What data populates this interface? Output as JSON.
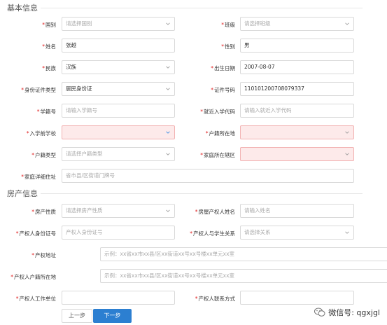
{
  "sections": {
    "basic": "基本信息",
    "property": "房产信息"
  },
  "basic": {
    "country_label": "国别",
    "country_placeholder": "请选择国别",
    "class_label": "班级",
    "class_placeholder": "请选择班级",
    "name_label": "姓名",
    "name_value": "张越",
    "gender_label": "性别",
    "gender_value": "男",
    "ethnicity_label": "民族",
    "ethnicity_value": "汉族",
    "birthdate_label": "出生日期",
    "birthdate_value": "2007-08-07",
    "idtype_label": "身份证件类型",
    "idtype_value": "居民身份证",
    "idnum_label": "证件号码",
    "idnum_value": "110101200708079337",
    "studentno_label": "学籍号",
    "studentno_placeholder": "请输入学籍号",
    "admission_label": "就近入学代码",
    "admission_placeholder": "请输入就近入学代码",
    "preschool_label": "入学前学校",
    "hukou_label": "户籍所在地",
    "hukoutype_label": "户籍类型",
    "hukoutype_placeholder": "请选择户籍类型",
    "district_label": "家庭所在辖区",
    "address_label": "家庭详细住址",
    "address_placeholder": "省市县/区街道门牌号"
  },
  "property": {
    "nature_label": "房产性质",
    "nature_placeholder": "请选择房产性质",
    "owner_name_label": "房屋产权人姓名",
    "owner_name_placeholder": "请输入姓名",
    "owner_id_label": "产权人身份证号",
    "owner_id_placeholder": "产权人身份证号",
    "relation_label": "产权人与学生关系",
    "relation_placeholder": "请选择关系",
    "address_label": "产权地址",
    "address_placeholder": "示例：xx省xx市xx县/区xx街道xx号xx号楼xx单元xx室",
    "owner_hukou_label": "产权人户籍所在地",
    "owner_hukou_placeholder": "示例：xx省xx市xx县/区xx街道xx号xx号楼xx单元xx室",
    "owner_work_label": "产权人工作单位",
    "owner_contact_label": "产权人联系方式"
  },
  "buttons": {
    "prev": "上一步",
    "next": "下一步"
  },
  "watermark": "微信号: qgxjgl"
}
